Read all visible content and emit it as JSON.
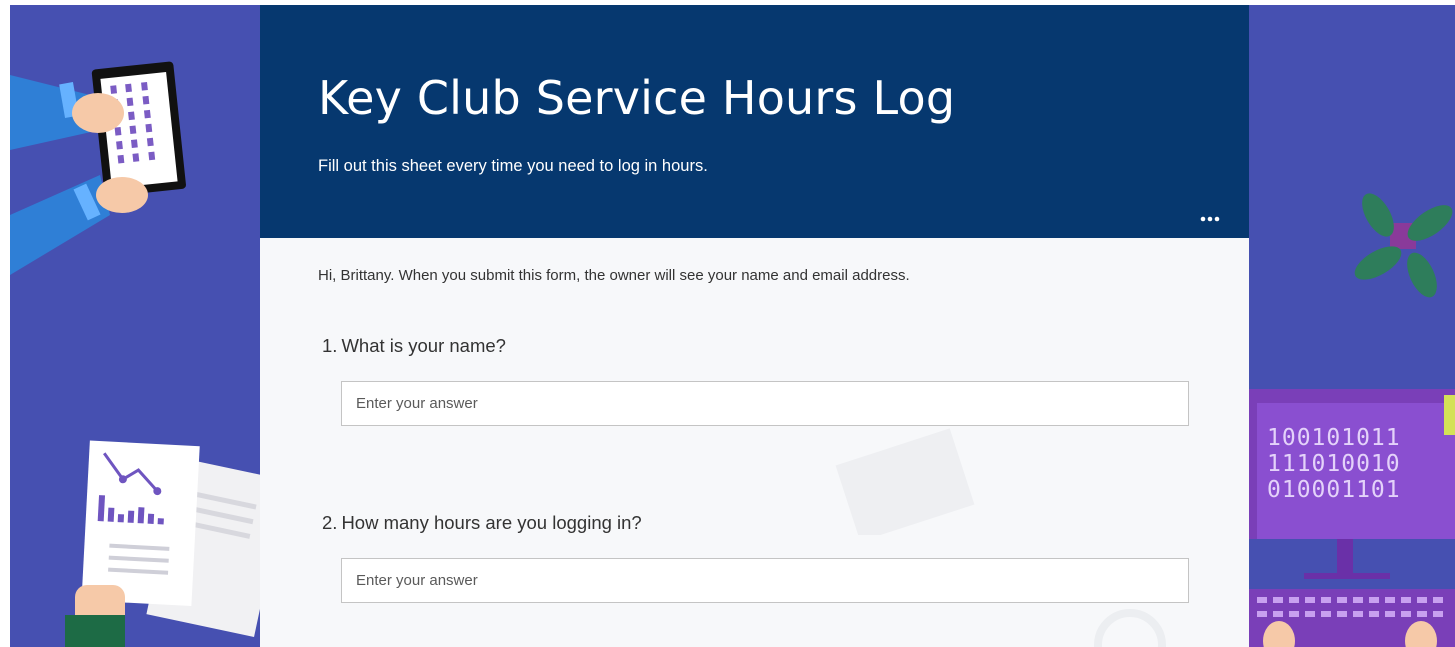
{
  "form": {
    "title": "Key Club Service Hours Log",
    "subtitle": "Fill out this sheet every time you need to log in hours.",
    "notice": "Hi, Brittany. When you submit this form, the owner will see your name and email address.",
    "more_icon": "ellipsis-icon",
    "questions": [
      {
        "number": "1.",
        "text": "What is your name?",
        "value": "",
        "placeholder": "Enter your answer"
      },
      {
        "number": "2.",
        "text": "How many hours are you logging in?",
        "value": "",
        "placeholder": "Enter your answer"
      }
    ]
  },
  "background": {
    "binary_lines": [
      "100101011",
      "111010010",
      "010001101"
    ],
    "colors": {
      "background": "#4650b1",
      "banner": "#06386f",
      "card": "#f7f8fa",
      "monitor_screen": "#8a4fd0",
      "leaf": "#2e7d5b"
    }
  }
}
